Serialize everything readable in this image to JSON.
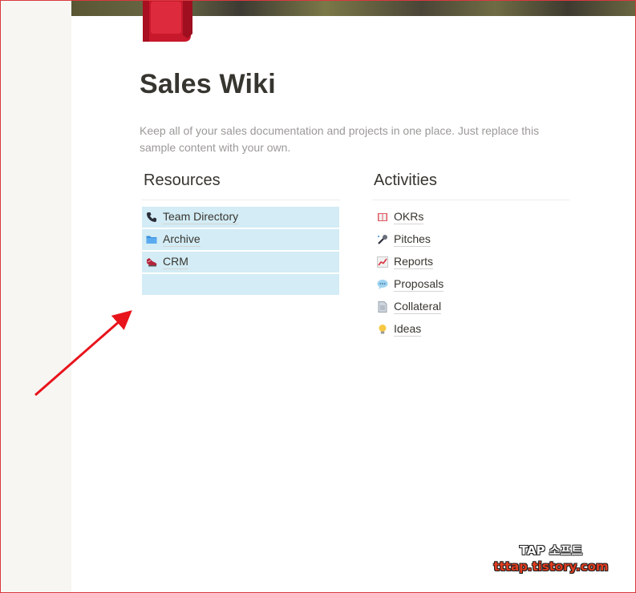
{
  "page": {
    "title": "Sales Wiki",
    "description": "Keep all of your sales documentation and projects in one place. Just replace this sample content with your own.",
    "icon": "red-book-icon"
  },
  "resources": {
    "heading": "Resources",
    "items": [
      {
        "label": "Team Directory",
        "icon": "telephone-icon"
      },
      {
        "label": "Archive",
        "icon": "folder-icon"
      },
      {
        "label": "CRM",
        "icon": "shoe-icon"
      },
      {
        "label": "",
        "icon": ""
      }
    ]
  },
  "activities": {
    "heading": "Activities",
    "items": [
      {
        "label": "OKRs",
        "icon": "book-icon"
      },
      {
        "label": "Pitches",
        "icon": "microphone-icon"
      },
      {
        "label": "Reports",
        "icon": "chart-increasing-icon"
      },
      {
        "label": "Proposals",
        "icon": "speech-bubble-icon"
      },
      {
        "label": "Collateral",
        "icon": "page-icon"
      },
      {
        "label": "Ideas",
        "icon": "light-bulb-icon"
      }
    ]
  },
  "watermark": {
    "line1": "TAP 소프트",
    "line2": "tttap.tistory.com"
  },
  "colors": {
    "selection": "#d3ecf5",
    "arrow": "#e8131b",
    "sidebar": "#f7f6f3"
  }
}
